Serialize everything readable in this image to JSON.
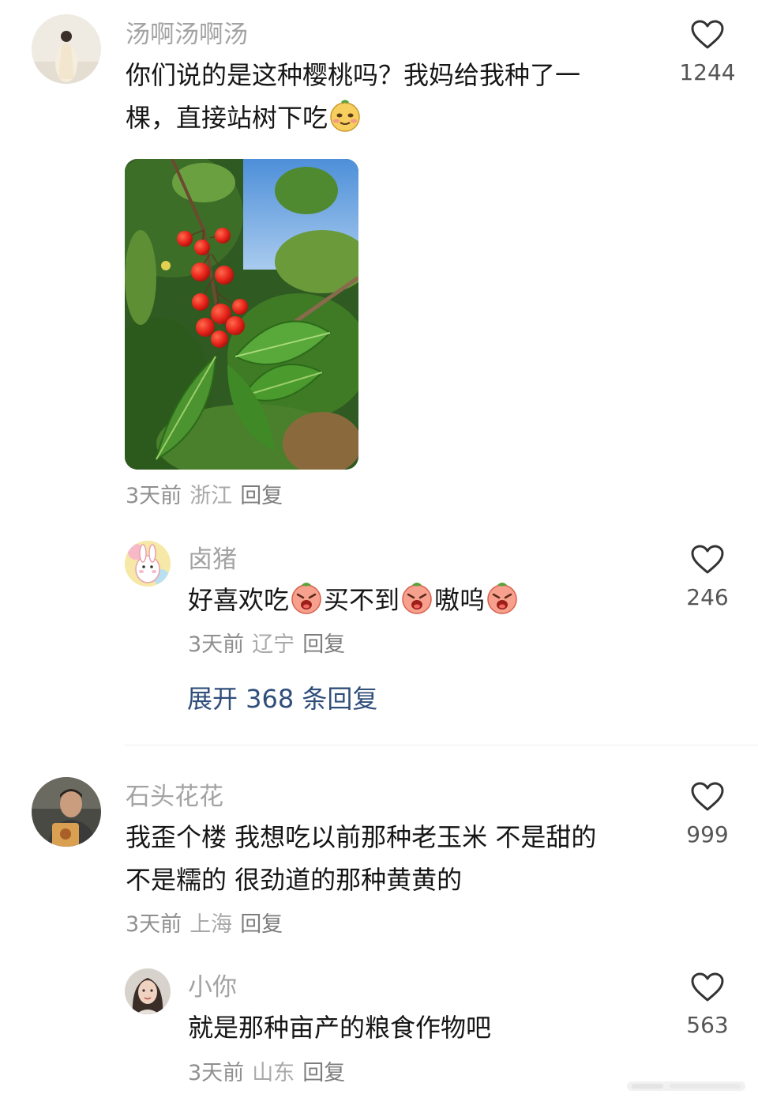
{
  "comments": [
    {
      "username": "汤啊汤啊汤",
      "text_line1": "你们说的是这种樱桃吗？我妈给我种了一",
      "text_line2": "棵，直接站树下吃",
      "time": "3天前",
      "location": "浙江",
      "reply_label": "回复",
      "likes": "1244",
      "emoji": "smirk-face-emoji"
    },
    {
      "username": "卤猪",
      "text_parts": [
        "好喜欢吃",
        "买不到",
        "嗷呜"
      ],
      "time": "3天前",
      "location": "辽宁",
      "reply_label": "回复",
      "likes": "246",
      "emoji": "crying-peach-emoji"
    },
    {
      "username": "石头花花",
      "text_line1": "我歪个楼 我想吃以前那种老玉米 不是甜的",
      "text_line2": "不是糯的 很劲道的那种黄黄的",
      "time": "3天前",
      "location": "上海",
      "reply_label": "回复",
      "likes": "999"
    },
    {
      "username": "小你",
      "text_line1": "就是那种亩产的粮食作物吧",
      "time": "3天前",
      "location": "山东",
      "reply_label": "回复",
      "likes": "563"
    }
  ],
  "expand_replies": "展开 368 条回复",
  "colors": {
    "username": "#a3a3a3",
    "link": "#2f4e7a",
    "cherry": "#e8251b",
    "leaf": "#3f7a25"
  }
}
